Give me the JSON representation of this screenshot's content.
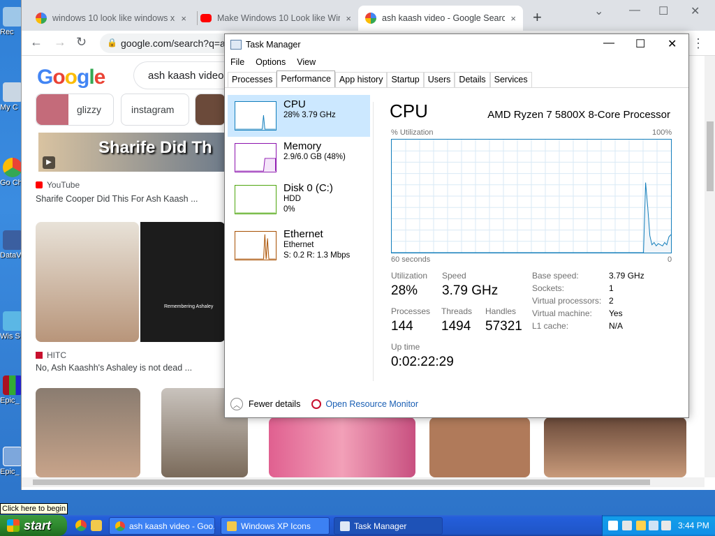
{
  "desktop": {
    "icons": [
      {
        "label": "Rec"
      },
      {
        "label": "My C"
      },
      {
        "label": "Go Ch"
      },
      {
        "label": "DataV"
      },
      {
        "label": "Wis S"
      },
      {
        "label": "Epic_"
      },
      {
        "label": "Epic_"
      }
    ]
  },
  "browser": {
    "tabs": [
      {
        "title": "windows 10 look like windows xp",
        "close": "×"
      },
      {
        "title": "Make Windows 10 Look like Win",
        "close": "×"
      },
      {
        "title": "ash kaash video - Google Search",
        "close": "×"
      }
    ],
    "new_tab": "+",
    "url": "google.com/search?q=a",
    "search_query": "ash kaash video",
    "chips": [
      {
        "label": "glizzy"
      },
      {
        "label": "instagram"
      }
    ],
    "results": [
      {
        "source": "YouTube",
        "title": "Sharife Cooper Did This For Ash Kaash ...",
        "thumb_text": "Sharife Did Th"
      },
      {
        "source": "HITC",
        "title": "No, Ash Kaashh's Ashaley is not dead ...",
        "thumb_caption": "Remembering Ashaley"
      }
    ],
    "logo_letters": [
      "G",
      "o",
      "o",
      "g",
      "l",
      "e"
    ]
  },
  "taskmanager": {
    "title": "Task Manager",
    "menu": [
      "File",
      "Options",
      "View"
    ],
    "tabs": [
      "Processes",
      "Performance",
      "App history",
      "Startup",
      "Users",
      "Details",
      "Services"
    ],
    "active_tab": "Performance",
    "resources": [
      {
        "name": "CPU",
        "line1": "28%  3.79 GHz",
        "line2": "",
        "color": "#117dbb"
      },
      {
        "name": "Memory",
        "line1": "2.9/6.0 GB (48%)",
        "line2": "",
        "color": "#8b12ae"
      },
      {
        "name": "Disk 0 (C:)",
        "line1": "HDD",
        "line2": "0%",
        "color": "#4da60c"
      },
      {
        "name": "Ethernet",
        "line1": "Ethernet",
        "line2": "S: 0.2  R: 1.3 Mbps",
        "color": "#a74f01"
      }
    ],
    "cpu": {
      "heading": "CPU",
      "processor": "AMD Ryzen 7 5800X 8-Core Processor",
      "util_label": "% Utilization",
      "util_max": "100%",
      "time_label": "60 seconds",
      "time_end": "0",
      "utilization_label": "Utilization",
      "utilization": "28%",
      "speed_label": "Speed",
      "speed": "3.79 GHz",
      "processes_label": "Processes",
      "processes": "144",
      "threads_label": "Threads",
      "threads": "1494",
      "handles_label": "Handles",
      "handles": "57321",
      "uptime_label": "Up time",
      "uptime": "0:02:22:29",
      "specs": [
        {
          "k": "Base speed:",
          "v": "3.79 GHz"
        },
        {
          "k": "Sockets:",
          "v": "1"
        },
        {
          "k": "Virtual processors:",
          "v": "2"
        },
        {
          "k": "Virtual machine:",
          "v": "Yes"
        },
        {
          "k": "L1 cache:",
          "v": "N/A"
        }
      ],
      "history": [
        0,
        0,
        0,
        0,
        0,
        0,
        0,
        0,
        0,
        0,
        0,
        0,
        0,
        0,
        0,
        0,
        0,
        0,
        0,
        0,
        0,
        0,
        0,
        0,
        0,
        0,
        0,
        0,
        0,
        0,
        0,
        0,
        0,
        0,
        0,
        0,
        0,
        0,
        0,
        0,
        0,
        0,
        0,
        0,
        0,
        0,
        0,
        0,
        0,
        0,
        0,
        0,
        0,
        0,
        0,
        0,
        0,
        0,
        0,
        0,
        0,
        0,
        0,
        0,
        0,
        0,
        0,
        0,
        0,
        0,
        0,
        0,
        0,
        0,
        0,
        0,
        0,
        0,
        0,
        0,
        0,
        0,
        0,
        0,
        0,
        0,
        0,
        0,
        0,
        0,
        0,
        0,
        0,
        0,
        0,
        0,
        0,
        0,
        0,
        0,
        0,
        0,
        0,
        0,
        0,
        0,
        0,
        0,
        0,
        0,
        0,
        0,
        0,
        0,
        0,
        0,
        0,
        0,
        0,
        0,
        62,
        40,
        15,
        7,
        9,
        6,
        8,
        7,
        6,
        9,
        7,
        14,
        16
      ]
    },
    "footer": {
      "fewer": "Fewer details",
      "resmon": "Open Resource Monitor"
    }
  },
  "taskbar": {
    "tooltip": "Click here to begin",
    "start": "start",
    "buttons": [
      {
        "label": "ash kaash video - Goo..."
      },
      {
        "label": "Windows XP Icons"
      },
      {
        "label": "Task Manager"
      }
    ],
    "clock": "3:44 PM"
  }
}
